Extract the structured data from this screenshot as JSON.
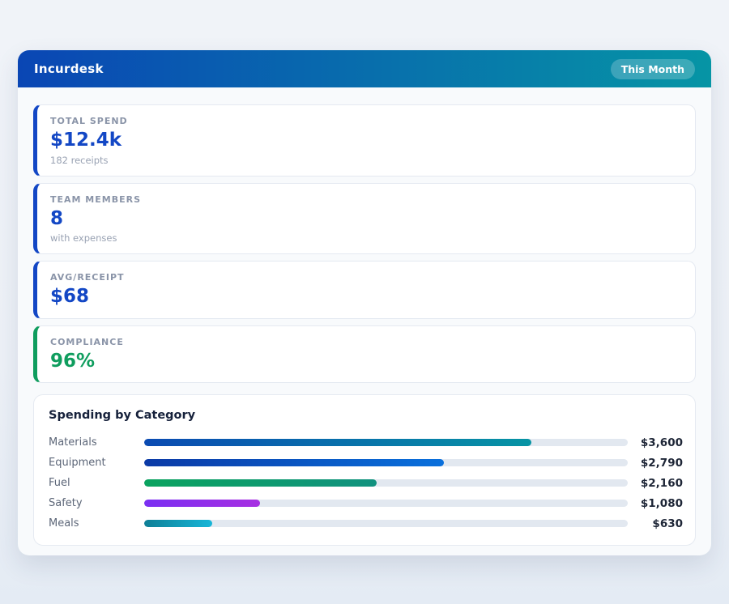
{
  "header": {
    "title": "Incurdesk",
    "badge": "This Month",
    "gradient_from": "#0a46b4",
    "gradient_to": "#0695a5"
  },
  "stats": [
    {
      "label": "TOTAL SPEND",
      "value": "$12.4k",
      "sub": "182 receipts",
      "accent": "#1347c5"
    },
    {
      "label": "TEAM MEMBERS",
      "value": "8",
      "sub": "with expenses",
      "accent": "#1347c5"
    },
    {
      "label": "AVG/RECEIPT",
      "value": "$68",
      "sub": "",
      "accent": "#1347c5"
    },
    {
      "label": "COMPLIANCE",
      "value": "96%",
      "sub": "",
      "accent": "#0f9d5e"
    }
  ],
  "category_section": {
    "title": "Spending by Category"
  },
  "chart_data": {
    "type": "bar",
    "orientation": "horizontal",
    "title": "Spending by Category",
    "categories": [
      "Materials",
      "Equipment",
      "Fuel",
      "Safety",
      "Meals"
    ],
    "values": [
      3600,
      2790,
      2160,
      1080,
      630
    ],
    "value_labels": [
      "$3,600",
      "$2,790",
      "$2,160",
      "$1,080",
      "$630"
    ],
    "axis_max": 4500,
    "track_color": "#e2e8f0",
    "bar_gradients": [
      [
        "#0a4ab2",
        "#0794a4"
      ],
      [
        "#0b3aa6",
        "#0a70dc"
      ],
      [
        "#0ba35f",
        "#11927f"
      ],
      [
        "#7a2ff2",
        "#a72fe2"
      ],
      [
        "#0e7f96",
        "#18b6d8"
      ]
    ]
  }
}
